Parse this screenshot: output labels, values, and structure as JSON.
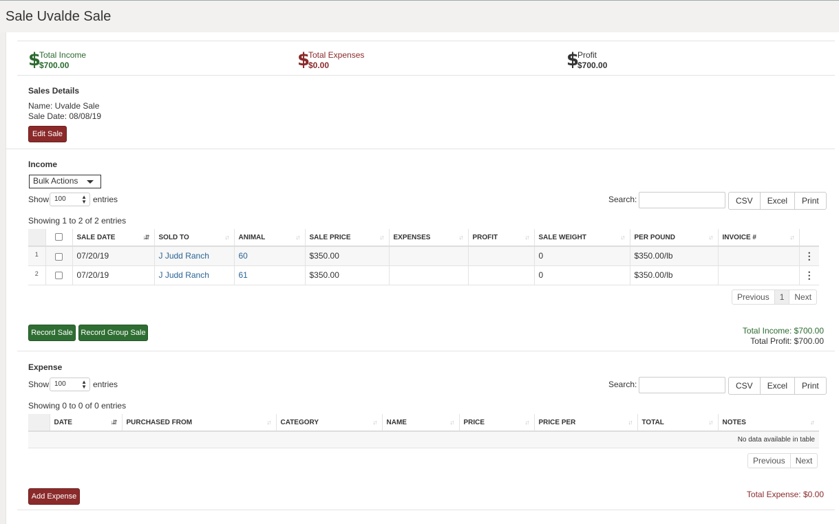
{
  "page": {
    "title": "Sale Uvalde Sale"
  },
  "stats": {
    "income": {
      "label": "Total Income",
      "value": "$700.00",
      "color": "#2b6a2f"
    },
    "expenses": {
      "label": "Total Expenses",
      "value": "$0.00",
      "color": "#8b2a2a"
    },
    "profit": {
      "label": "Profit",
      "value": "$700.00",
      "color": "#333333"
    },
    "dollar_glyph": "$"
  },
  "details": {
    "title": "Sales Details",
    "name": "Name: Uvalde Sale",
    "date": "Sale Date: 08/08/19",
    "edit_label": "Edit Sale"
  },
  "income": {
    "title": "Income",
    "bulk_label": "Bulk Actions",
    "show_label": "Show",
    "entries_value": "100",
    "entries_label": "entries",
    "search_label": "Search:",
    "export": [
      "CSV",
      "Excel",
      "Print"
    ],
    "info": "Showing 1 to 2 of 2 entries",
    "columns": [
      "SALE DATE",
      "SOLD TO",
      "ANIMAL",
      "SALE PRICE",
      "EXPENSES",
      "PROFIT",
      "SALE WEIGHT",
      "PER POUND",
      "INVOICE #"
    ],
    "rows": [
      {
        "n": "1",
        "date": "07/20/19",
        "sold_to": "J Judd Ranch",
        "animal": "60",
        "price": "$350.00",
        "expenses": "",
        "profit": "",
        "weight": "0",
        "per_pound": "$350.00/lb",
        "invoice": ""
      },
      {
        "n": "2",
        "date": "07/20/19",
        "sold_to": "J Judd Ranch",
        "animal": "61",
        "price": "$350.00",
        "expenses": "",
        "profit": "",
        "weight": "0",
        "per_pound": "$350.00/lb",
        "invoice": ""
      }
    ],
    "pager": {
      "prev": "Previous",
      "page": "1",
      "next": "Next"
    },
    "record_sale": "Record Sale",
    "record_group_sale": "Record Group Sale",
    "total_income": "Total Income: $700.00",
    "total_profit": "Total Profit: $700.00"
  },
  "expense": {
    "title": "Expense",
    "show_label": "Show",
    "entries_value": "100",
    "entries_label": "entries",
    "search_label": "Search:",
    "export": [
      "CSV",
      "Excel",
      "Print"
    ],
    "info": "Showing 0 to 0 of 0 entries",
    "columns": [
      "DATE",
      "PURCHASED FROM",
      "CATEGORY",
      "NAME",
      "PRICE",
      "PRICE PER",
      "TOTAL",
      "NOTES"
    ],
    "empty": "No data available in table",
    "pager": {
      "prev": "Previous",
      "next": "Next"
    },
    "add_label": "Add Expense",
    "total_expense": "Total Expense: $0.00"
  },
  "colors": {
    "accent_red": "#8b2a2a",
    "accent_green": "#2f6e33",
    "link": "#2a6496"
  }
}
